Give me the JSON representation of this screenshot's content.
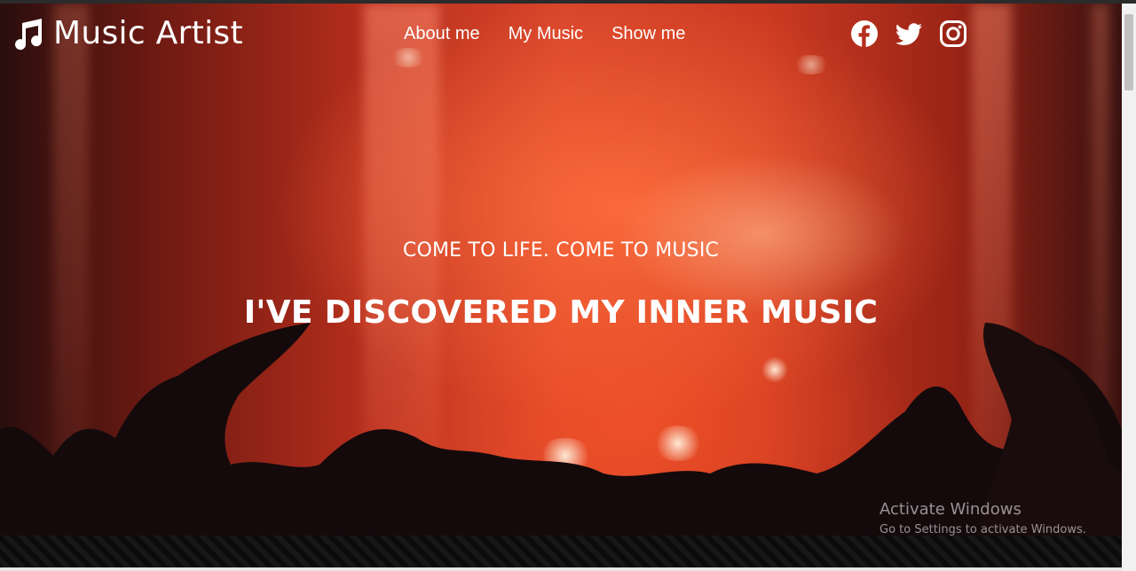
{
  "header": {
    "brand_icon": "music-note-icon",
    "brand_title": "Music Artist",
    "nav": [
      {
        "label": "About me"
      },
      {
        "label": "My Music"
      },
      {
        "label": "Show me"
      }
    ],
    "social": [
      {
        "icon": "facebook-icon"
      },
      {
        "icon": "twitter-icon"
      },
      {
        "icon": "instagram-icon"
      }
    ]
  },
  "hero": {
    "tagline": "COME TO LIFE. COME TO MUSIC",
    "headline": "I'VE DISCOVERED MY INNER MUSIC"
  },
  "watermark": {
    "title": "Activate Windows",
    "subtitle": "Go to Settings to activate Windows."
  },
  "colors": {
    "text": "#ffffff",
    "hero_red": "#d8442a",
    "dark": "#111111"
  }
}
